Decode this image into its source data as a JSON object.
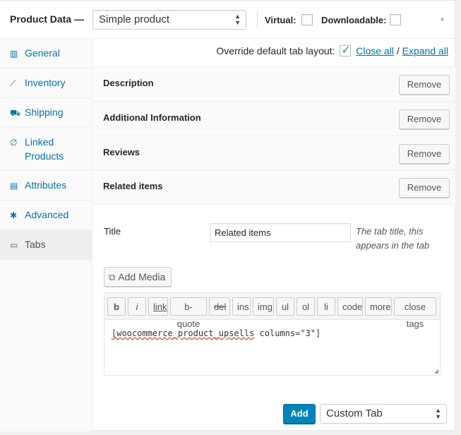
{
  "header": {
    "title": "Product Data —",
    "product_type": "Simple product",
    "virtual_label": "Virtual:",
    "downloadable_label": "Downloadable:"
  },
  "sidebar": {
    "items": [
      {
        "label": "General",
        "icon": "wrench-icon",
        "glyph": "▥"
      },
      {
        "label": "Inventory",
        "icon": "chart-icon",
        "glyph": "⟋"
      },
      {
        "label": "Shipping",
        "icon": "truck-icon",
        "glyph": "⛟"
      },
      {
        "label": "Linked Products",
        "icon": "link-icon",
        "glyph": "∅"
      },
      {
        "label": "Attributes",
        "icon": "list-icon",
        "glyph": "▤"
      },
      {
        "label": "Advanced",
        "icon": "gear-icon",
        "glyph": "✱"
      },
      {
        "label": "Tabs",
        "icon": "window-icon",
        "glyph": "▭"
      }
    ],
    "active_index": 6
  },
  "main": {
    "override_label": "Override default tab layout:",
    "close_all": "Close all",
    "separator": "/",
    "expand_all": "Expand all",
    "tabs": [
      {
        "name": "Description",
        "remove_label": "Remove"
      },
      {
        "name": "Additional Information",
        "remove_label": "Remove"
      },
      {
        "name": "Reviews",
        "remove_label": "Remove"
      },
      {
        "name": "Related items",
        "remove_label": "Remove"
      }
    ],
    "editor": {
      "title_label": "Title",
      "title_value": "Related items",
      "title_desc": "The tab title, this appears in the tab",
      "add_media_label": "Add Media",
      "quicktags": [
        "b",
        "i",
        "link",
        "b-quote",
        "del",
        "ins",
        "img",
        "ul",
        "ol",
        "li",
        "code",
        "more",
        "close tags"
      ],
      "content_part1": "[woocommerce_product_upsells",
      "content_part2": " columns=\"3\"]"
    },
    "add_label": "Add",
    "add_type": "Custom Tab"
  }
}
